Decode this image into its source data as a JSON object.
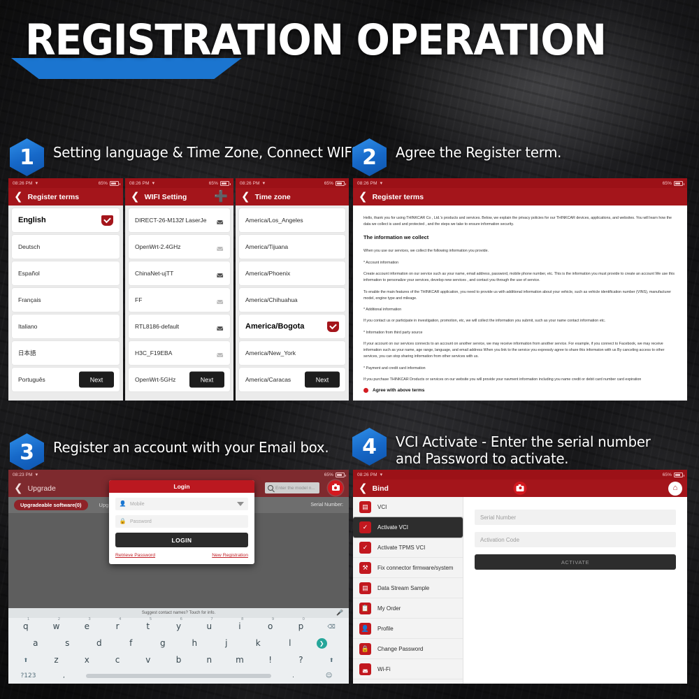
{
  "hero": {
    "title": "REGISTRATION OPERATION"
  },
  "steps": [
    {
      "num": "1",
      "text": "Setting language & Time Zone, Connect WIFI."
    },
    {
      "num": "2",
      "text": "Agree the Register term."
    },
    {
      "num": "3",
      "text": "Register an account with your Email box."
    },
    {
      "num": "4",
      "text": "VCI Activate - Enter the serial number and Password to activate."
    }
  ],
  "status": {
    "time": "08:26 PM",
    "time_alt": "08:23 PM",
    "battery": "65%",
    "wifi_icon": "wifi-icon"
  },
  "panel_language": {
    "title": "Register terms",
    "back_icon": "chevron-left-icon",
    "next_label": "Next",
    "items": [
      {
        "label": "English",
        "selected": true
      },
      {
        "label": "Deutsch",
        "selected": false
      },
      {
        "label": "Español",
        "selected": false
      },
      {
        "label": "Français",
        "selected": false
      },
      {
        "label": "Italiano",
        "selected": false
      },
      {
        "label": "日本語",
        "selected": false
      },
      {
        "label": "Português",
        "selected": false
      }
    ]
  },
  "panel_wifi": {
    "title": "WIFI Setting",
    "back_icon": "chevron-left-icon",
    "add_icon": "plus-circle-icon",
    "next_label": "Next",
    "networks": [
      {
        "ssid": "DIRECT-26-M132f LaserJe",
        "strength": "strong"
      },
      {
        "ssid": "OpenWrt-2.4GHz",
        "strength": "weak"
      },
      {
        "ssid": "ChinaNet-ujTT",
        "strength": "strong"
      },
      {
        "ssid": "FF",
        "strength": "weak"
      },
      {
        "ssid": "RTL8186-default",
        "strength": "strong"
      },
      {
        "ssid": "H3C_F19EBA",
        "strength": "weak"
      },
      {
        "ssid": "OpenWrt-5GHz",
        "strength": "strong"
      }
    ]
  },
  "panel_timezone": {
    "title": "Time zone",
    "back_icon": "chevron-left-icon",
    "next_label": "Next",
    "zones": [
      {
        "label": "America/Los_Angeles",
        "selected": false
      },
      {
        "label": "America/Tijuana",
        "selected": false
      },
      {
        "label": "America/Phoenix",
        "selected": false
      },
      {
        "label": "America/Chihuahua",
        "selected": false
      },
      {
        "label": "America/Bogota",
        "selected": true
      },
      {
        "label": "America/New_York",
        "selected": false
      },
      {
        "label": "America/Caracas",
        "selected": false
      }
    ]
  },
  "panel_terms": {
    "title": "Register terms",
    "back_icon": "chevron-left-icon",
    "paragraphs": [
      "Hello, thank you for using THINKCAR Co , Ltd.'s products and services. Below, we explain the privacy policies for our THINKCAR devices, applications, and websites. You will learn how the data we collect is used and protected , and the steps we take to ensure information security.",
      "The information we collect",
      "When you use our services, we collect the following information you provide.",
      "* Account information",
      "Create account information on our service such as your name, email address, password, mobile phone number, etc. This is the information you must provide to create an account We use this information to personalize your services, develop new services , and contact you through the use of service.",
      "To enable the main features of the THINKCAR application, you need to provide us with additional information about your vehicle, such as vehicle identification number (VINS), manufacturer model, engine type and mileage.",
      "* Additional information",
      "If you contact us or participate in investigation, promotion, etc, we will collect the information you submit, such as your name contact information etc.",
      "* Information from third party source",
      "If your account on our services connects to an account on another service, we may receive information from another service. For example, if you connect to Facebook, we may receive information such as your name, age range, language, and email address When you link to the service you expressly agree to share this informaton with us By canceling access to other services, you can stop sharing information from other services with us.",
      "* Payment and credit card information",
      "If you purchase THINKCAR Droducts or services on our website you will provide your navment information including you name credit or debit card number card expiration"
    ],
    "heading_index": 1,
    "agree_label": "Agree with above terms",
    "agree_radio_icon": "radio-selected-icon"
  },
  "panel_login": {
    "title": "Upgrade",
    "back_icon": "chevron-left-icon",
    "search_placeholder": "Enter the model n...",
    "search_icon": "search-icon",
    "camera_icon": "camera-icon",
    "tab_pill": "Upgradeable software(0)",
    "tab_secondary": "Upg",
    "serial_label": "Serial Number:",
    "dialog": {
      "title": "Login",
      "account_placeholder": "Mobile",
      "account_icon": "user-icon",
      "password_placeholder": "Password",
      "password_icon": "lock-icon",
      "dropdown_icon": "caret-down-icon",
      "submit_label": "LOGIN",
      "retrieve_label": "Retrieve Password",
      "register_label": "New Registration"
    },
    "keyboard": {
      "suggestion": "Suggest contact names? Touch for info.",
      "mic_icon": "microphone-icon",
      "row1": [
        {
          "k": "q",
          "n": "1"
        },
        {
          "k": "w",
          "n": "2"
        },
        {
          "k": "e",
          "n": "3"
        },
        {
          "k": "r",
          "n": "4"
        },
        {
          "k": "t",
          "n": "5"
        },
        {
          "k": "y",
          "n": "6"
        },
        {
          "k": "u",
          "n": "7"
        },
        {
          "k": "i",
          "n": "8"
        },
        {
          "k": "o",
          "n": "9"
        },
        {
          "k": "p",
          "n": "0"
        }
      ],
      "backspace_icon": "backspace-icon",
      "row2": [
        "a",
        "s",
        "d",
        "f",
        "g",
        "h",
        "j",
        "k",
        "l"
      ],
      "enter_icon": "enter-arrow-icon",
      "row3": [
        "z",
        "x",
        "c",
        "v",
        "b",
        "n",
        "m",
        "!",
        "?"
      ],
      "shift_icon": "shift-icon",
      "numeric_label": "?123",
      "comma": ",",
      "period": ".",
      "emoji_icon": "emoji-icon"
    }
  },
  "panel_bind": {
    "title": "Bind",
    "back_icon": "chevron-left-icon",
    "camera_icon": "camera-icon",
    "home_icon": "home-icon",
    "menu": [
      {
        "label": "VCI",
        "icon": "vci-device-icon",
        "active": false
      },
      {
        "label": "Activate VCI",
        "icon": "shield-check-icon",
        "active": true
      },
      {
        "label": "Activate TPMS VCI",
        "icon": "shield-check-icon",
        "active": false
      },
      {
        "label": "Fix connector firmware/system",
        "icon": "tools-icon",
        "active": false
      },
      {
        "label": "Data Stream Sample",
        "icon": "chart-icon",
        "active": false
      },
      {
        "label": "My Order",
        "icon": "clipboard-icon",
        "active": false
      },
      {
        "label": "Profile",
        "icon": "profile-card-icon",
        "active": false
      },
      {
        "label": "Change Password",
        "icon": "lock-icon",
        "active": false
      },
      {
        "label": "Wi-Fi",
        "icon": "wifi-icon",
        "active": false
      }
    ],
    "serial_placeholder": "Serial Number",
    "activation_placeholder": "Activation Code",
    "activate_label": "ACTIVATE"
  },
  "colors": {
    "brand_red": "#a4151b",
    "accent_blue": "#1b75d0",
    "dark_button": "#2b2b2b",
    "status_red": "#9c1117"
  }
}
